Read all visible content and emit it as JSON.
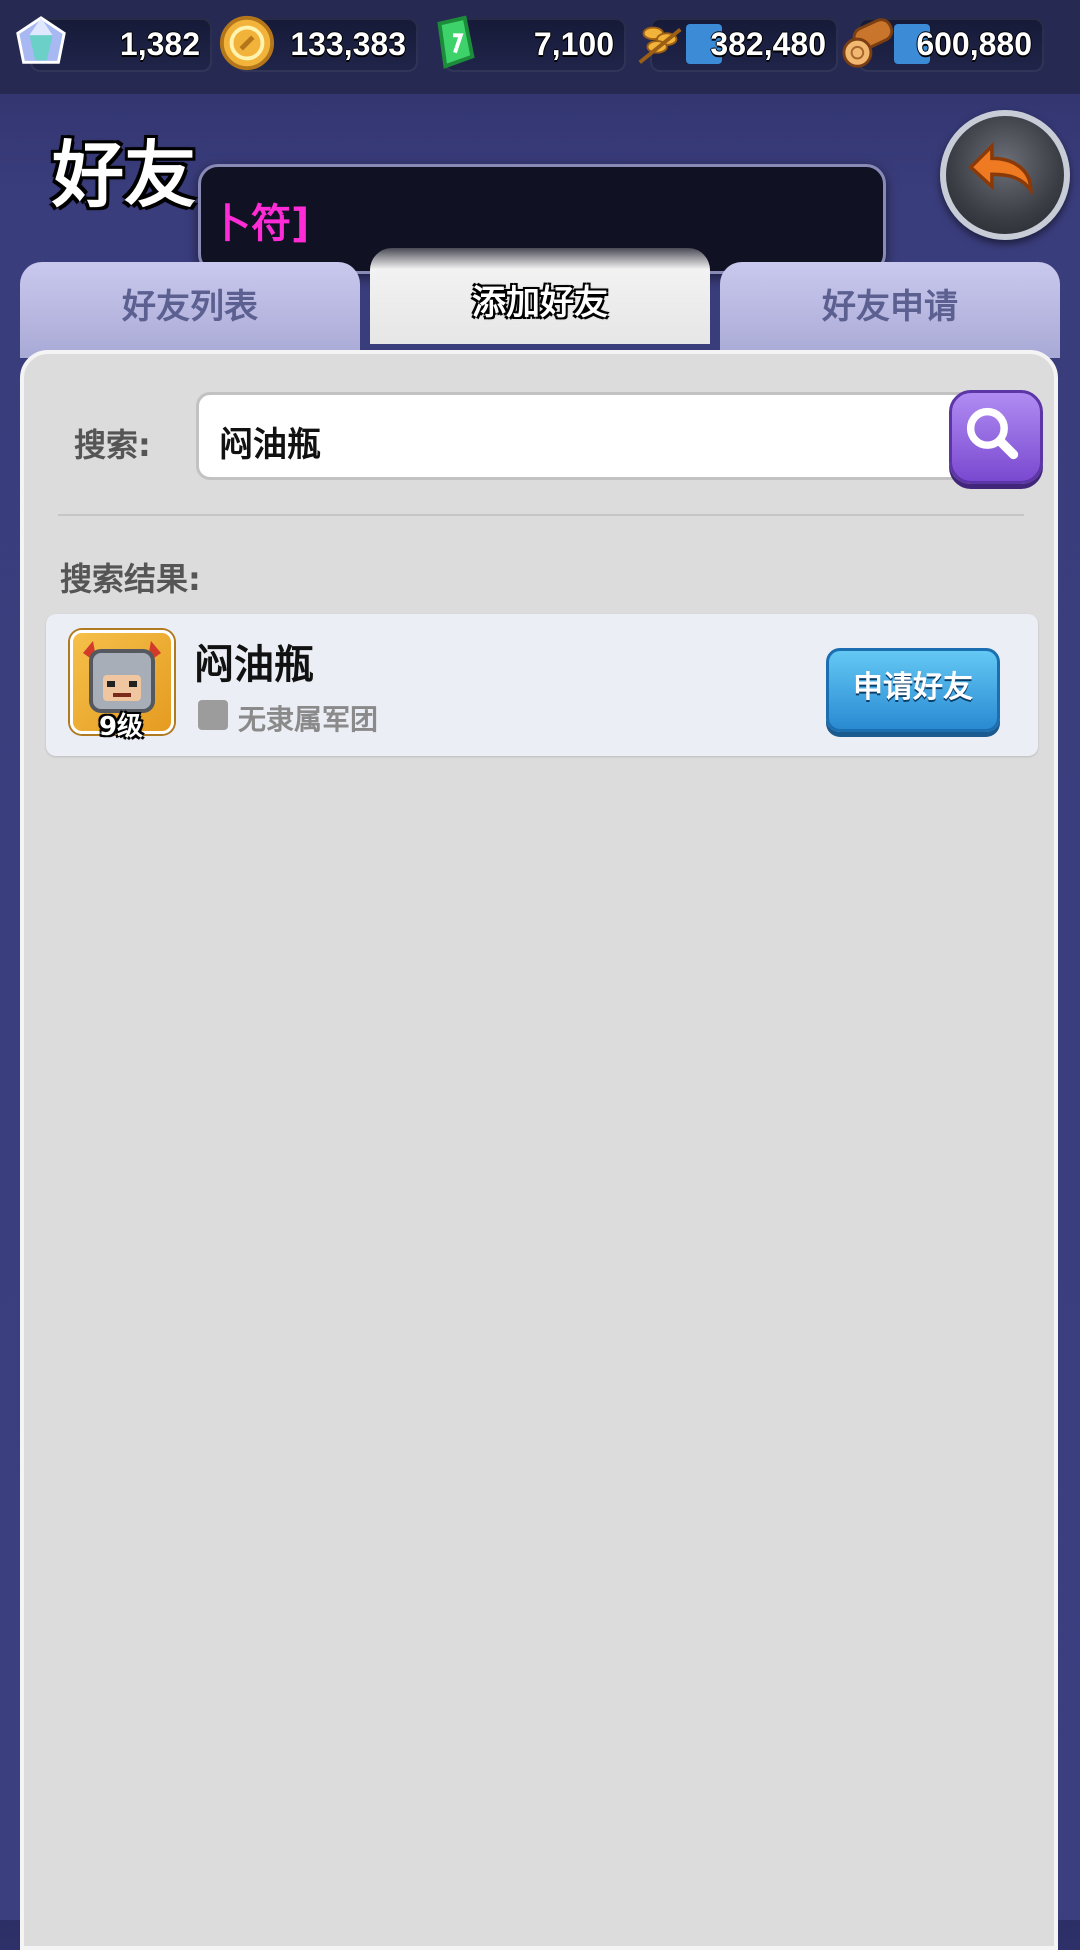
{
  "resources": [
    {
      "name": "diamond",
      "value": "1,382",
      "icon": "gem-icon",
      "color": "#b8c6ff"
    },
    {
      "name": "gold",
      "value": "133,383",
      "icon": "coin-icon",
      "color": "#f2b33a"
    },
    {
      "name": "badge",
      "value": "7,100",
      "icon": "green-badge-icon",
      "color": "#3dd26a"
    },
    {
      "name": "wheat",
      "value": "382,480",
      "icon": "wheat-icon",
      "color": "#e8a42e"
    },
    {
      "name": "wood",
      "value": "600,880",
      "icon": "log-icon",
      "color": "#d68b3a"
    }
  ],
  "header": {
    "title": "好友",
    "tooltip_text": "卜符]"
  },
  "tabs": [
    {
      "label": "好友列表",
      "active": false
    },
    {
      "label": "添加好友",
      "active": true
    },
    {
      "label": "好友申请",
      "active": false
    }
  ],
  "search": {
    "label": "搜索:",
    "value": "闷油瓶"
  },
  "results": {
    "label": "搜索结果:",
    "items": [
      {
        "name": "闷油瓶",
        "level": "9级",
        "legion": "无隶属军团",
        "action": "申请好友"
      }
    ]
  }
}
